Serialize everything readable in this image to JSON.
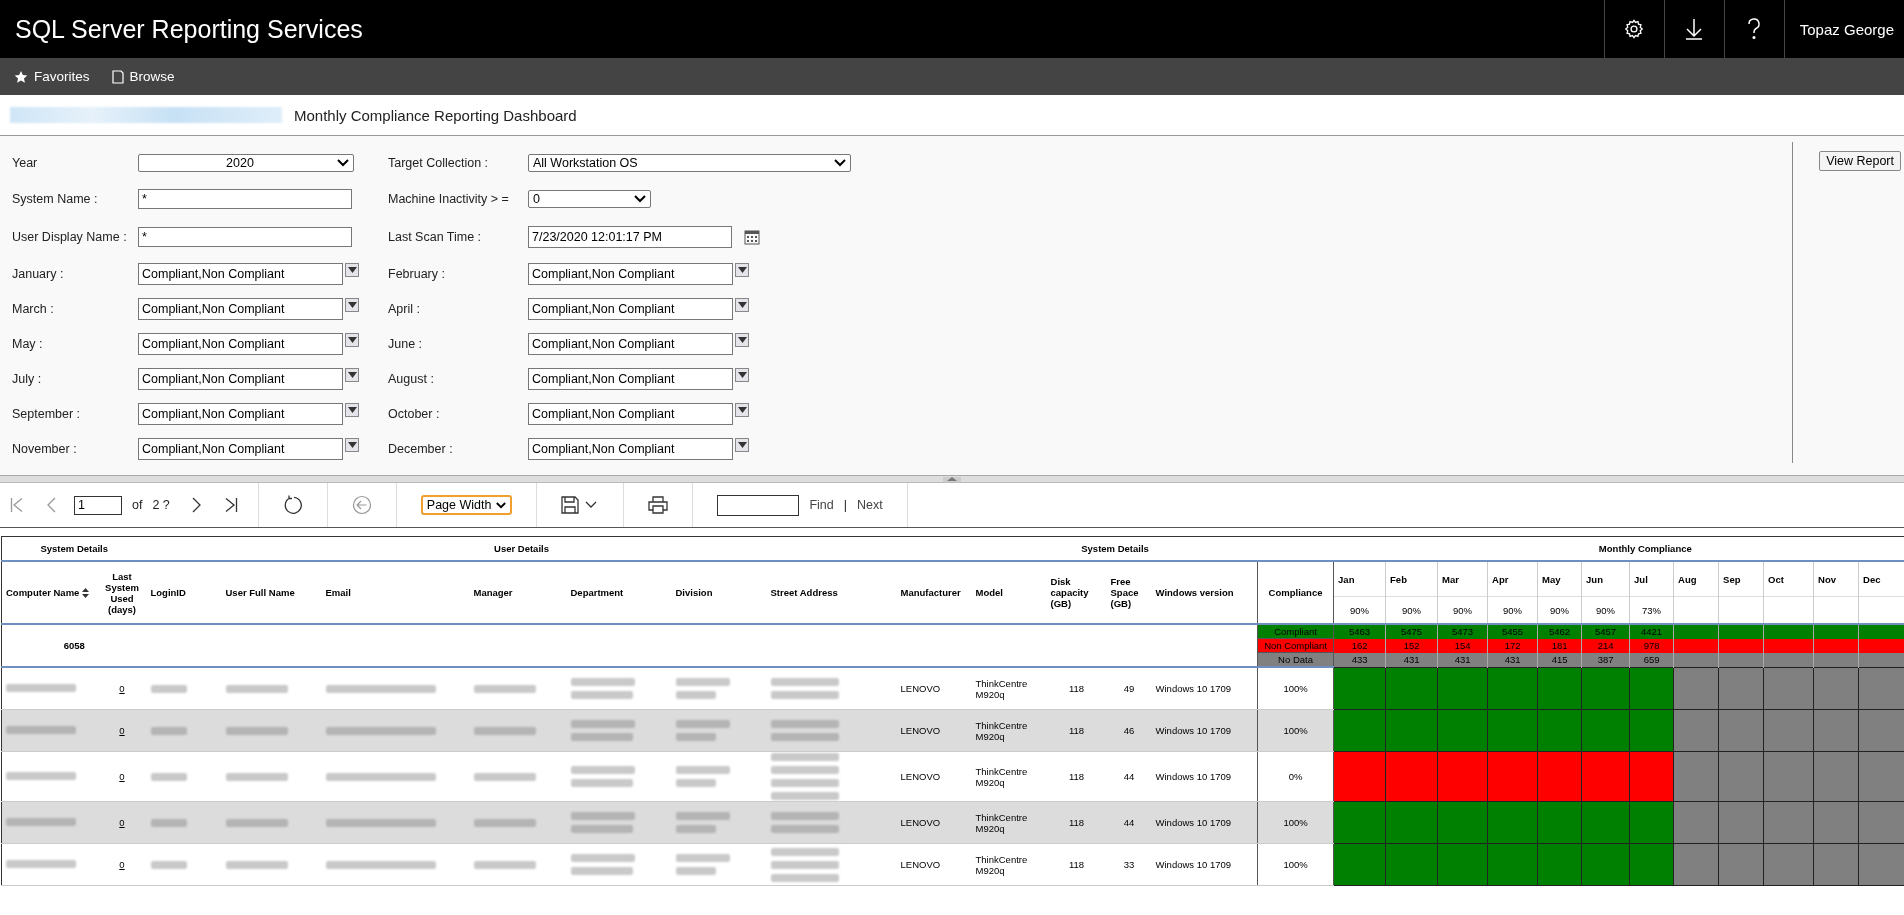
{
  "header": {
    "title": "SQL Server Reporting Services",
    "user": "Topaz George"
  },
  "nav": [
    {
      "label": "Favorites"
    },
    {
      "label": "Browse"
    }
  ],
  "breadcrumb": {
    "current": "Monthly Compliance Reporting Dashboard"
  },
  "params": [
    [
      {
        "label": "Year",
        "kind": "select",
        "value": "2020"
      },
      {
        "label": "Target Collection :",
        "kind": "wideselect",
        "value": "All Workstation OS"
      }
    ],
    [
      {
        "label": "System Name :",
        "kind": "text",
        "value": "*"
      },
      {
        "label": "Machine Inactivity > =",
        "kind": "smallselect",
        "value": "0"
      }
    ],
    [
      {
        "label": "User Display Name :",
        "kind": "text",
        "value": "*"
      },
      {
        "label": "Last Scan Time :",
        "kind": "date",
        "value": "7/23/2020 12:01:17 PM"
      }
    ],
    [
      {
        "label": "January :",
        "kind": "multi",
        "value": "Compliant,Non Compliant"
      },
      {
        "label": "February :",
        "kind": "multi",
        "value": "Compliant,Non Compliant"
      }
    ],
    [
      {
        "label": "March :",
        "kind": "multi",
        "value": "Compliant,Non Compliant"
      },
      {
        "label": "April :",
        "kind": "multi",
        "value": "Compliant,Non Compliant"
      }
    ],
    [
      {
        "label": "May :",
        "kind": "multi",
        "value": "Compliant,Non Compliant"
      },
      {
        "label": "June :",
        "kind": "multi",
        "value": "Compliant,Non Compliant"
      }
    ],
    [
      {
        "label": "July :",
        "kind": "multi",
        "value": "Compliant,Non Compliant"
      },
      {
        "label": "August :",
        "kind": "multi",
        "value": "Compliant,Non Compliant"
      }
    ],
    [
      {
        "label": "September :",
        "kind": "multi",
        "value": "Compliant,Non Compliant"
      },
      {
        "label": "October :",
        "kind": "multi",
        "value": "Compliant,Non Compliant"
      }
    ],
    [
      {
        "label": "November :",
        "kind": "multi",
        "value": "Compliant,Non Compliant"
      },
      {
        "label": "December :",
        "kind": "multi",
        "value": "Compliant,Non Compliant"
      }
    ]
  ],
  "view_report_button": "View Report",
  "toolbar": {
    "page": "1",
    "of": "of",
    "total": "2 ?",
    "zoom": "Page Width",
    "find": "Find",
    "separator": "|",
    "next": "Next"
  },
  "table": {
    "groups": [
      {
        "label": "System Details"
      },
      {
        "label": "User Details"
      },
      {
        "label": "System Details"
      },
      {
        "label": "Monthly Compliance"
      }
    ],
    "columns": [
      {
        "label": "Computer Name",
        "sortable": true
      },
      {
        "label": "Last System Used (days)",
        "sortable": false
      },
      {
        "label": "LoginID",
        "sortable": false
      },
      {
        "label": "User Full Name",
        "sortable": false
      },
      {
        "label": "Email",
        "sortable": false
      },
      {
        "label": "Manager",
        "sortable": false
      },
      {
        "label": "Department",
        "sortable": false
      },
      {
        "label": "Division",
        "sortable": false
      },
      {
        "label": "Street Address",
        "sortable": false
      },
      {
        "label": "Manufacturer",
        "sortable": false
      },
      {
        "label": "Model",
        "sortable": false
      },
      {
        "label": "Disk capacity (GB)",
        "sortable": false
      },
      {
        "label": "Free Space (GB)",
        "sortable": false
      },
      {
        "label": "Windows version",
        "sortable": false
      },
      {
        "label": "Compliance",
        "sortable": false
      }
    ],
    "months": [
      {
        "name": "Jan",
        "pct": "90%"
      },
      {
        "name": "Feb",
        "pct": "90%"
      },
      {
        "name": "Mar",
        "pct": "90%"
      },
      {
        "name": "Apr",
        "pct": "90%"
      },
      {
        "name": "May",
        "pct": "90%"
      },
      {
        "name": "Jun",
        "pct": "90%"
      },
      {
        "name": "Jul",
        "pct": "73%"
      },
      {
        "name": "Aug"
      },
      {
        "name": "Sep"
      },
      {
        "name": "Oct"
      },
      {
        "name": "Nov"
      },
      {
        "name": "Dec"
      }
    ],
    "total": "6058",
    "summary": [
      {
        "label": "Compliant",
        "color": "#008000",
        "values": [
          "5463",
          "5475",
          "5473",
          "5455",
          "5462",
          "5457",
          "4421"
        ]
      },
      {
        "label": "Non Compliant",
        "color": "#ff0000",
        "values": [
          "162",
          "152",
          "154",
          "172",
          "181",
          "214",
          "978"
        ]
      },
      {
        "label": "No Data",
        "color": "#808080",
        "values": [
          "433",
          "431",
          "431",
          "431",
          "415",
          "387",
          "659"
        ]
      }
    ],
    "rows": [
      {
        "last_used": "0",
        "manufacturer": "LENOVO",
        "model": "ThinkCentre M920q",
        "disk": "118",
        "free": "49",
        "windows": "Windows 10 1709",
        "compliance": "100%",
        "months": [
          {
            "color": "#008000"
          },
          {
            "color": "#008000"
          },
          {
            "color": "#008000"
          },
          {
            "color": "#008000"
          },
          {
            "color": "#008000"
          },
          {
            "color": "#008000"
          },
          {
            "color": "#008000"
          },
          {
            "color": "#808080"
          },
          {
            "color": "#808080"
          },
          {
            "color": "#808080"
          },
          {
            "color": "#808080"
          },
          {
            "color": "#808080"
          }
        ]
      },
      {
        "last_used": "0",
        "manufacturer": "LENOVO",
        "model": "ThinkCentre M920q",
        "disk": "118",
        "free": "46",
        "windows": "Windows 10 1709",
        "compliance": "100%",
        "months": [
          {
            "color": "#008000"
          },
          {
            "color": "#008000"
          },
          {
            "color": "#008000"
          },
          {
            "color": "#008000"
          },
          {
            "color": "#008000"
          },
          {
            "color": "#008000"
          },
          {
            "color": "#008000"
          },
          {
            "color": "#808080"
          },
          {
            "color": "#808080"
          },
          {
            "color": "#808080"
          },
          {
            "color": "#808080"
          },
          {
            "color": "#808080"
          }
        ]
      },
      {
        "last_used": "0",
        "manufacturer": "LENOVO",
        "model": "ThinkCentre M920q",
        "disk": "118",
        "free": "44",
        "windows": "Windows 10 1709",
        "compliance": "0%",
        "months": [
          {
            "color": "#ff0000"
          },
          {
            "color": "#ff0000"
          },
          {
            "color": "#ff0000"
          },
          {
            "color": "#ff0000"
          },
          {
            "color": "#ff0000"
          },
          {
            "color": "#ff0000"
          },
          {
            "color": "#ff0000"
          },
          {
            "color": "#808080"
          },
          {
            "color": "#808080"
          },
          {
            "color": "#808080"
          },
          {
            "color": "#808080"
          },
          {
            "color": "#808080"
          }
        ]
      },
      {
        "last_used": "0",
        "manufacturer": "LENOVO",
        "model": "ThinkCentre M920q",
        "disk": "118",
        "free": "44",
        "windows": "Windows 10 1709",
        "compliance": "100%",
        "months": [
          {
            "color": "#008000"
          },
          {
            "color": "#008000"
          },
          {
            "color": "#008000"
          },
          {
            "color": "#008000"
          },
          {
            "color": "#008000"
          },
          {
            "color": "#008000"
          },
          {
            "color": "#008000"
          },
          {
            "color": "#808080"
          },
          {
            "color": "#808080"
          },
          {
            "color": "#808080"
          },
          {
            "color": "#808080"
          },
          {
            "color": "#808080"
          }
        ]
      },
      {
        "last_used": "0",
        "manufacturer": "LENOVO",
        "model": "ThinkCentre M920q",
        "disk": "118",
        "free": "33",
        "windows": "Windows 10 1709",
        "compliance": "100%",
        "months": [
          {
            "color": "#008000"
          },
          {
            "color": "#008000"
          },
          {
            "color": "#008000"
          },
          {
            "color": "#008000"
          },
          {
            "color": "#008000"
          },
          {
            "color": "#008000"
          },
          {
            "color": "#008000"
          },
          {
            "color": "#808080"
          },
          {
            "color": "#808080"
          },
          {
            "color": "#808080"
          },
          {
            "color": "#808080"
          },
          {
            "color": "#808080"
          }
        ]
      }
    ]
  }
}
